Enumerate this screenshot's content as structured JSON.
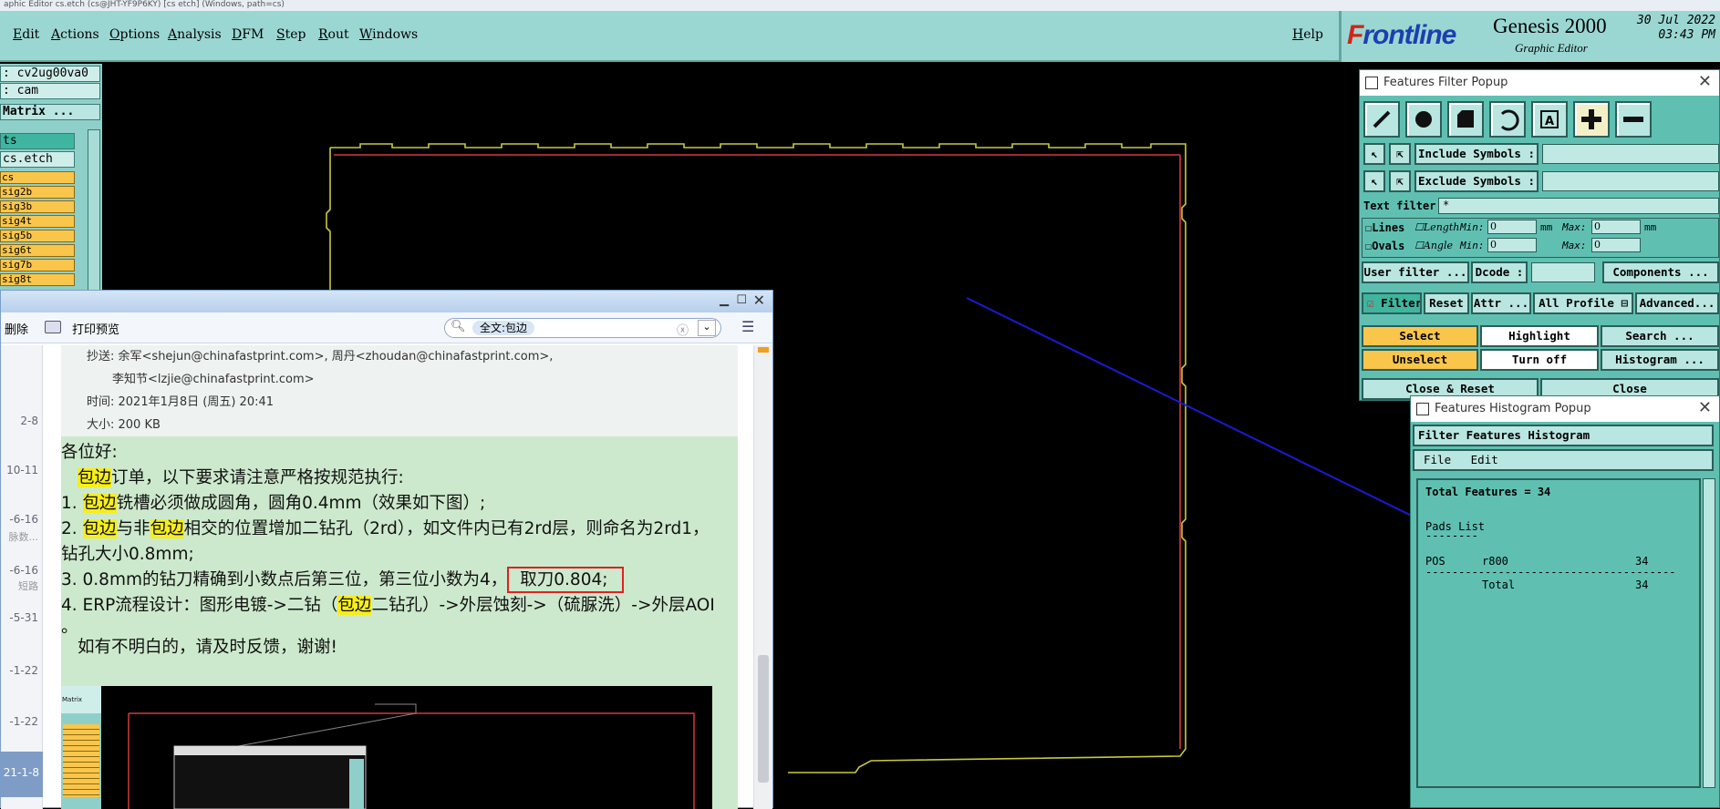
{
  "window_title": "aphic Editor cs.etch (cs@JHT-YF9P6KY) [cs etch] (Windows, path=cs)",
  "menu": [
    "Edit",
    "Actions",
    "Options",
    "Analysis",
    "DFM",
    "Step",
    "Rout",
    "Windows"
  ],
  "help": "Help",
  "brand": {
    "logo_a": "F",
    "logo_b": "rontline",
    "product": "Genesis 2000",
    "subtitle": "Graphic Editor",
    "date": "30 Jul 2022",
    "time": "03:43 PM"
  },
  "left_panel": {
    "job": ": cv2ug00va0",
    "user": ": cam",
    "matrix": "Matrix ...",
    "group": "ts",
    "step": "cs.etch",
    "layers": [
      "cs",
      "sig2b",
      "sig3b",
      "sig4t",
      "sig5b",
      "sig6t",
      "sig7b",
      "sig8t"
    ]
  },
  "email": {
    "toolbar": {
      "delete": "删除",
      "print_preview": "打印预览",
      "search_tag": "全文:包边"
    },
    "header": {
      "cc_label": "抄送:",
      "cc_line1": "余军<shejun@chinafastprint.com>, 周丹<zhoudan@chinafastprint.com>,",
      "cc_line2": "李知节<lzjie@chinafastprint.com>",
      "time": "时间: 2021年1月8日 (周五) 20:41",
      "size": "大小: 200 KB"
    },
    "list_dates": [
      "2-8",
      "10-11",
      "-6-16",
      "-6-16",
      "-5-31",
      "-1-22",
      "-1-22",
      "21-1-8"
    ],
    "list_snips": [
      "脉数...",
      "短路"
    ],
    "body": {
      "greeting": "各位好:",
      "kw": "包边",
      "l1b": "订单，以下要求请注意严格按规范执行:",
      "l2a": "1. ",
      "l2b": "铣槽必须做成圆角，圆角0.4mm（效果如下图）;",
      "l3a": "2. ",
      "l3b": "与非",
      "l3c": "相交的位置增加二钻孔（2rd），如文件内已有2rd层，则命名为2rd1，",
      "l4": "钻孔大小0.8mm;",
      "l5a": "3. 0.8mm的钻刀精确到小数点后第三位，第三位小数为4，",
      "l5b": "取刀0.804;",
      "l6a": "4. ERP流程设计：图形电镀->二钻（",
      "l6b": "二钻孔）->外层蚀刻->（硫脲洗）->外层AOI",
      "l7": "。",
      "l8": "如有不明白的，请及时反馈，谢谢!"
    },
    "thumb_label": "Matrix"
  },
  "filter_popup": {
    "title": "Features Filter Popup",
    "include": "Include Symbols :",
    "exclude": "Exclude Symbols :",
    "text_filter_label": "Text filter",
    "text_filter_value": "*",
    "lines": "Lines",
    "ovals": "Ovals",
    "length": "Length",
    "angle": "Angle",
    "min": "Min:",
    "max": "Max:",
    "zero": "0",
    "unit": "mm",
    "user_filter": "User filter ...",
    "dcode": "Dcode :",
    "components": "Components ...",
    "filter": "Filter",
    "reset": "Reset",
    "attr": "Attr ...",
    "profile": "All Profile",
    "advanced": "Advanced...",
    "select": "Select",
    "highlight": "Highlight",
    "search": "Search ...",
    "unselect": "Unselect",
    "turn_off": "Turn off",
    "histogram": "Histogram ...",
    "close_reset": "Close & Reset",
    "close": "Close"
  },
  "histogram_popup": {
    "title": "Features Histogram Popup",
    "header": "Filter Features Histogram",
    "menu_file": "File",
    "menu_edit": "Edit",
    "total_line": "Total Features = 34",
    "pads_list": "Pads List",
    "col_pos": "POS",
    "sym": "r800",
    "count": "34",
    "total_label": "Total",
    "total_count": "34"
  },
  "colors": {
    "teal": "#9bd7d2",
    "popup": "#5fc0b2",
    "layer": "#f9c64b",
    "highlight": "#f7ee1a",
    "arrow": "#1a1ad4"
  }
}
